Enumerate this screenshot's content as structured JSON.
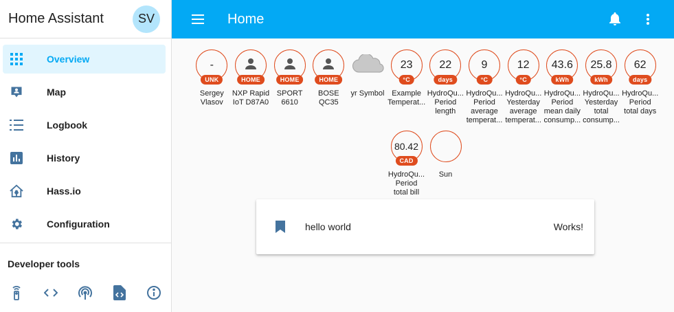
{
  "sidebar": {
    "title": "Home Assistant",
    "avatar": "SV",
    "items": [
      {
        "label": "Overview",
        "icon": "apps-icon",
        "active": true
      },
      {
        "label": "Map",
        "icon": "map-account-icon"
      },
      {
        "label": "Logbook",
        "icon": "format-list-bulleted-icon"
      },
      {
        "label": "History",
        "icon": "chart-box-icon"
      },
      {
        "label": "Hass.io",
        "icon": "hassio-icon"
      },
      {
        "label": "Configuration",
        "icon": "settings-icon"
      }
    ],
    "dev_title": "Developer tools",
    "dev_tools": [
      "remote-icon",
      "code-tags-icon",
      "access-point-icon",
      "file-xml-icon",
      "information-outline-icon"
    ]
  },
  "header": {
    "title": "Home",
    "icons": [
      "menu-icon",
      "bell-icon",
      "dots-vertical-icon"
    ]
  },
  "badges": [
    {
      "value": "-",
      "unit": "UNK",
      "label": [
        "Sergey",
        "Vlasov"
      ]
    },
    {
      "value": "",
      "unit": "HOME",
      "icon": "account-icon",
      "label": [
        "NXP Rapid",
        "IoT D87A0"
      ]
    },
    {
      "value": "",
      "unit": "HOME",
      "icon": "account-icon",
      "label": [
        "SPORT",
        "6610"
      ]
    },
    {
      "value": "",
      "unit": "HOME",
      "icon": "account-icon",
      "label": [
        "BOSE",
        "QC35"
      ]
    },
    {
      "value": "",
      "unit": "",
      "icon": "cloud-icon",
      "label": [
        "yr Symbol"
      ]
    },
    {
      "value": "23",
      "unit": "°C",
      "label": [
        "Example",
        "Temperat..."
      ]
    },
    {
      "value": "22",
      "unit": "days",
      "label": [
        "HydroQu...",
        "Period",
        "length"
      ]
    },
    {
      "value": "9",
      "unit": "°C",
      "label": [
        "HydroQu...",
        "Period",
        "average",
        "temperat..."
      ]
    },
    {
      "value": "12",
      "unit": "°C",
      "label": [
        "HydroQu...",
        "Yesterday",
        "average",
        "temperat..."
      ]
    },
    {
      "value": "43.6",
      "unit": "kWh",
      "label": [
        "HydroQu...",
        "Period",
        "mean daily",
        "consump..."
      ]
    },
    {
      "value": "25.8",
      "unit": "kWh",
      "label": [
        "HydroQu...",
        "Yesterday",
        "total",
        "consump..."
      ]
    },
    {
      "value": "62",
      "unit": "days",
      "label": [
        "HydroQu...",
        "Period",
        "total days"
      ]
    },
    {
      "value": "80.42",
      "unit": "CAD",
      "label": [
        "HydroQu...",
        "Period",
        "total bill"
      ]
    },
    {
      "value": "",
      "unit": "",
      "icon": "moon-icon",
      "label": [
        "Sun"
      ]
    }
  ],
  "card": {
    "icon": "bookmark-icon",
    "name": "hello world",
    "state": "Works!"
  },
  "colors": {
    "primary": "#03a9f4",
    "badge_accent": "#df4c1e",
    "active_bg": "#e1f5fe",
    "icon_grey": "#44739e"
  }
}
